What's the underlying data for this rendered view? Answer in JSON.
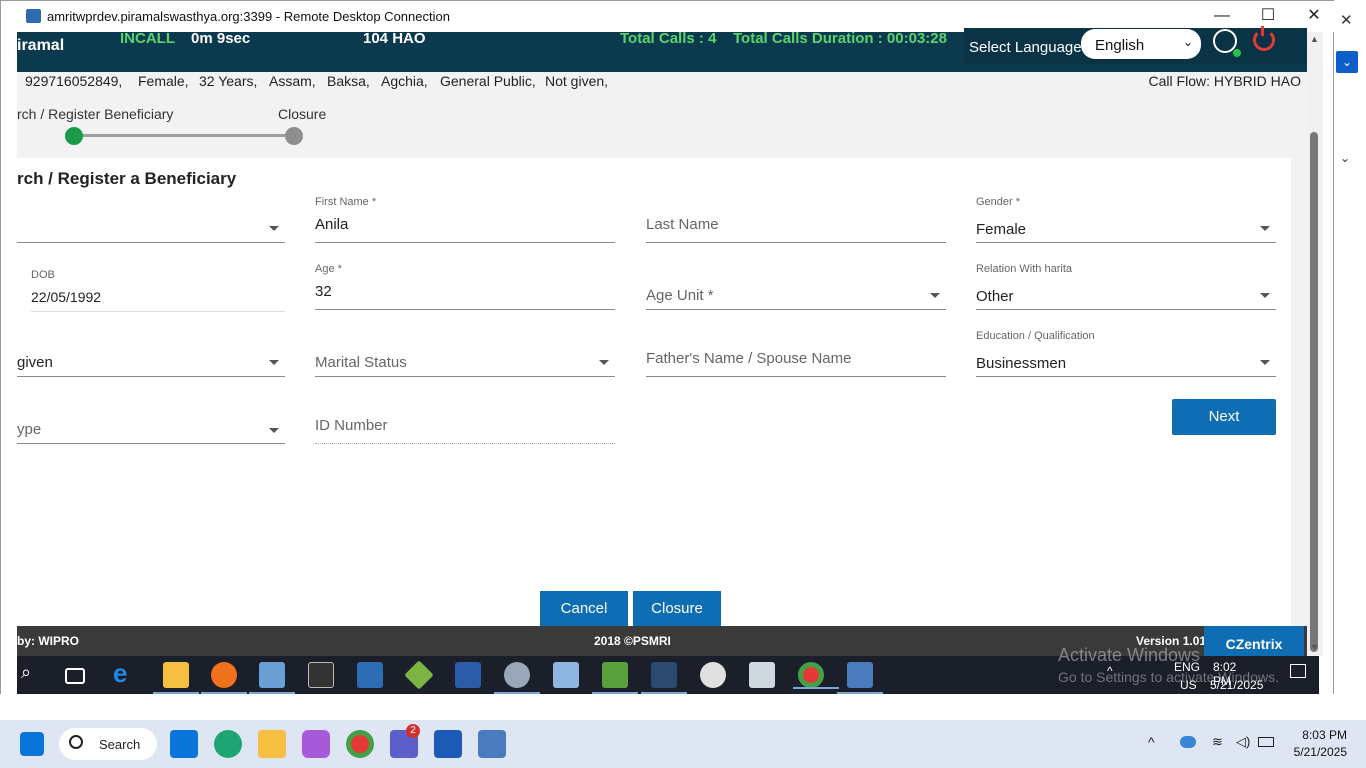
{
  "window": {
    "title": "amritwprdev.piramalswasthya.org:3399 - Remote Desktop Connection"
  },
  "app": {
    "brand": "iramal",
    "call_status": "INCALL",
    "call_timer": "0m 9sec",
    "service": "104 HAO",
    "total_calls": "Total Calls : 4",
    "total_duration": "Total Calls Duration : 00:03:28",
    "language_label": "Select Language:",
    "language_value": "English"
  },
  "caller_info": {
    "phone": "929716052849,",
    "gender": "Female,",
    "age": "32 Years,",
    "state": "Assam,",
    "district": "Baksa,",
    "block": "Agchia,",
    "category": "General Public,",
    "other": "Not given,",
    "call_flow": "Call Flow: HYBRID HAO"
  },
  "stepper": {
    "step1": "rch / Register Beneficiary",
    "step2": "Closure"
  },
  "form": {
    "title": "rch / Register a Beneficiary",
    "first_name_label": "First Name *",
    "first_name_value": "Anila",
    "last_name_placeholder": "Last Name",
    "gender_label": "Gender *",
    "gender_value": "Female",
    "dob_label": "DOB",
    "dob_value": "22/05/1992",
    "age_label": "Age *",
    "age_value": "32",
    "age_unit_placeholder": "Age Unit *",
    "relation_label": "Relation With harita",
    "relation_value": "Other",
    "left_row3_value": "given",
    "marital_placeholder": "Marital Status",
    "father_placeholder": "Father's Name / Spouse Name",
    "education_label": "Education / Qualification",
    "education_value": "Businessmen",
    "id_type_placeholder": "ype",
    "id_number_placeholder": "ID Number",
    "next_label": "Next",
    "cancel_label": "Cancel",
    "closure_label": "Closure"
  },
  "footer": {
    "left": "by: WIPRO",
    "center": "2018 ©PSMRI",
    "version": "Version 1.01",
    "brand": "CZentrix"
  },
  "remote_tray": {
    "lang": "ENG",
    "region": "US",
    "time": "8:02 PM",
    "date": "5/21/2025"
  },
  "watermark": {
    "line1": "Activate Windows",
    "line2": "Go to Settings to activate Windows."
  },
  "host_taskbar": {
    "search_label": "Search",
    "time": "8:03 PM",
    "date": "5/21/2025",
    "teams_badge": "2"
  },
  "colors": {
    "header_bg": "#0b3a4f",
    "accent_green": "#5bd46a",
    "button_blue": "#0f6db3",
    "step_active": "#1a9b4b"
  }
}
